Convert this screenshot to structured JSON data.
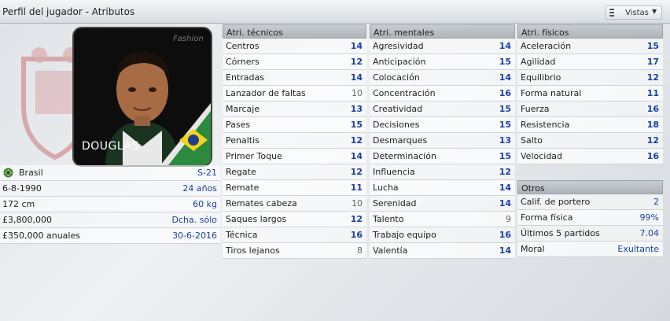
{
  "window": {
    "title": "Perfil del jugador - Atributos",
    "vistas_label": "Vistas"
  },
  "player": {
    "name": "DOUGLAS",
    "photo_tag": "Fashion",
    "info": [
      {
        "left": "Brasil",
        "right": "S-21"
      },
      {
        "left": "6-8-1990",
        "right": "24 años"
      },
      {
        "left": "172 cm",
        "right": "60 kg"
      },
      {
        "left": "£3,800,000",
        "right": "Dcha. sólo"
      },
      {
        "left": "£350,000 anuales",
        "right": "30-6-2016"
      }
    ]
  },
  "tecnicos": {
    "header": "Atri. técnicos",
    "items": [
      {
        "name": "Centros",
        "value": "14"
      },
      {
        "name": "Córners",
        "value": "12"
      },
      {
        "name": "Entradas",
        "value": "14"
      },
      {
        "name": "Lanzador de faltas",
        "value": "10"
      },
      {
        "name": "Marcaje",
        "value": "13"
      },
      {
        "name": "Pases",
        "value": "15"
      },
      {
        "name": "Penaltis",
        "value": "12"
      },
      {
        "name": "Primer Toque",
        "value": "14"
      },
      {
        "name": "Regate",
        "value": "12"
      },
      {
        "name": "Remate",
        "value": "11"
      },
      {
        "name": "Remates cabeza",
        "value": "10"
      },
      {
        "name": "Saques largos",
        "value": "12"
      },
      {
        "name": "Técnica",
        "value": "16"
      },
      {
        "name": "Tiros lejanos",
        "value": "8"
      }
    ]
  },
  "mentales": {
    "header": "Atri. mentales",
    "items": [
      {
        "name": "Agresividad",
        "value": "14"
      },
      {
        "name": "Anticipación",
        "value": "15"
      },
      {
        "name": "Colocación",
        "value": "14"
      },
      {
        "name": "Concentración",
        "value": "16"
      },
      {
        "name": "Creatividad",
        "value": "15"
      },
      {
        "name": "Decisiones",
        "value": "15"
      },
      {
        "name": "Desmarques",
        "value": "13"
      },
      {
        "name": "Determinación",
        "value": "15"
      },
      {
        "name": "Influencia",
        "value": "12"
      },
      {
        "name": "Lucha",
        "value": "14"
      },
      {
        "name": "Serenidad",
        "value": "14"
      },
      {
        "name": "Talento",
        "value": "9"
      },
      {
        "name": "Trabajo equipo",
        "value": "16"
      },
      {
        "name": "Valentía",
        "value": "14"
      }
    ]
  },
  "fisicos": {
    "header": "Atri. físicos",
    "items": [
      {
        "name": "Aceleración",
        "value": "15"
      },
      {
        "name": "Agilidad",
        "value": "17"
      },
      {
        "name": "Equilibrio",
        "value": "12"
      },
      {
        "name": "Forma natural",
        "value": "11"
      },
      {
        "name": "Fuerza",
        "value": "16"
      },
      {
        "name": "Resistencia",
        "value": "18"
      },
      {
        "name": "Salto",
        "value": "12"
      },
      {
        "name": "Velocidad",
        "value": "16"
      }
    ]
  },
  "otros": {
    "header": "Otros",
    "items": [
      {
        "name": "Calif. de portero",
        "value": "2"
      },
      {
        "name": "Forma física",
        "value": "99%"
      },
      {
        "name": "Últimos 5 partidos",
        "value": "7.04"
      },
      {
        "name": "Moral",
        "value": "Exultante"
      }
    ]
  },
  "colors": {
    "value_blue": "#1a3fa8",
    "value_grey": "#666666",
    "header_bg": "#b8bdc3"
  }
}
